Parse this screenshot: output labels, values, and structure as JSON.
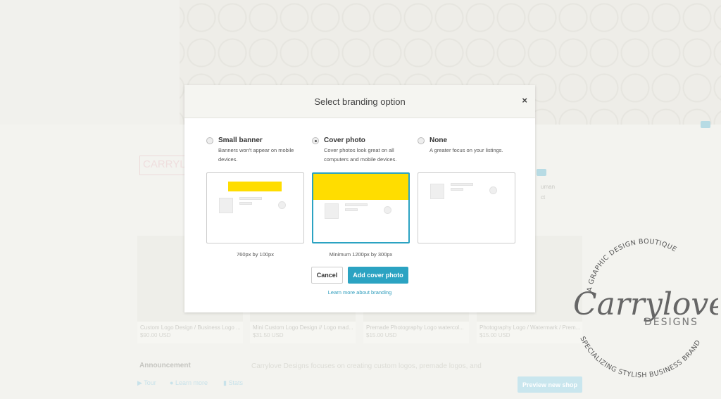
{
  "background": {
    "shop_logo_text": "CARRYL",
    "owner_partial": "uman",
    "contact_partial": "ct",
    "listings": [
      {
        "title": "Custom Logo Design / Business Logo ...",
        "price": "$90.00 USD"
      },
      {
        "title": "Mini Custom Logo Design // Logo mad...",
        "price": "$31.50 USD"
      },
      {
        "title": "Premade Photography Logo watercol...",
        "price": "$15.00 USD"
      },
      {
        "title": "Photography Logo / Watermark / Prem...",
        "price": "$15.00 USD"
      }
    ],
    "announcement_label": "Announcement",
    "announcement_text": "Carrylove Designs focuses on creating custom logos, premade logos, and",
    "bottom": {
      "tour": "Tour",
      "learn_more": "Learn more",
      "stats": "Stats",
      "preview": "Preview new shop"
    }
  },
  "modal": {
    "title": "Select branding option",
    "close": "×",
    "options": [
      {
        "label": "Small banner",
        "desc": "Banners won't appear on mobile devices.",
        "dimensions": "760px by 100px",
        "selected": false
      },
      {
        "label": "Cover photo",
        "desc": "Cover photos look great on all computers and mobile devices.",
        "dimensions": "Minimum 1200px by 300px",
        "selected": true
      },
      {
        "label": "None",
        "desc": "A greater focus on your listings.",
        "dimensions": "",
        "selected": false
      }
    ],
    "cancel": "Cancel",
    "add": "Add cover photo",
    "learn": "Learn more about branding",
    "accent": "#2ba3c2",
    "highlight": "#ffdd00"
  },
  "watermark": {
    "top": "A GRAPHIC DESIGN BOUTIQUE",
    "name": "Carrylove",
    "sub": "DESIGNS",
    "bottom": "SPECIALIZING STYLISH BUSINESS BRANDING"
  }
}
